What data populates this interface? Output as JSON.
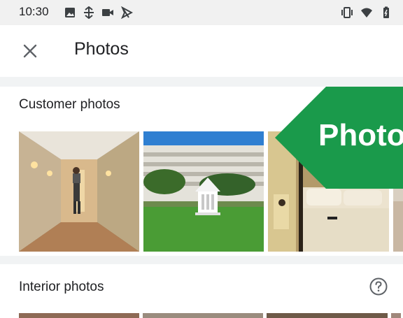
{
  "status_bar": {
    "time": "10:30",
    "left_icons": [
      "image-icon",
      "sync-icon",
      "video-icon",
      "send-icon"
    ],
    "right_icons": [
      "vibrate-icon",
      "wifi-icon",
      "battery-icon"
    ]
  },
  "app_bar": {
    "close_icon": "close-icon",
    "title": "Photos"
  },
  "customer_photos": {
    "heading": "Customer photos",
    "photos": [
      "hotel-hallway-photo",
      "hotel-exterior-gazebo-photo",
      "hotel-bedroom-photo",
      "partial-photo"
    ]
  },
  "banner": {
    "text": "Photos",
    "color": "#1a9a4b"
  },
  "interior_photos": {
    "heading": "Interior photos",
    "help_icon": "help-icon"
  }
}
